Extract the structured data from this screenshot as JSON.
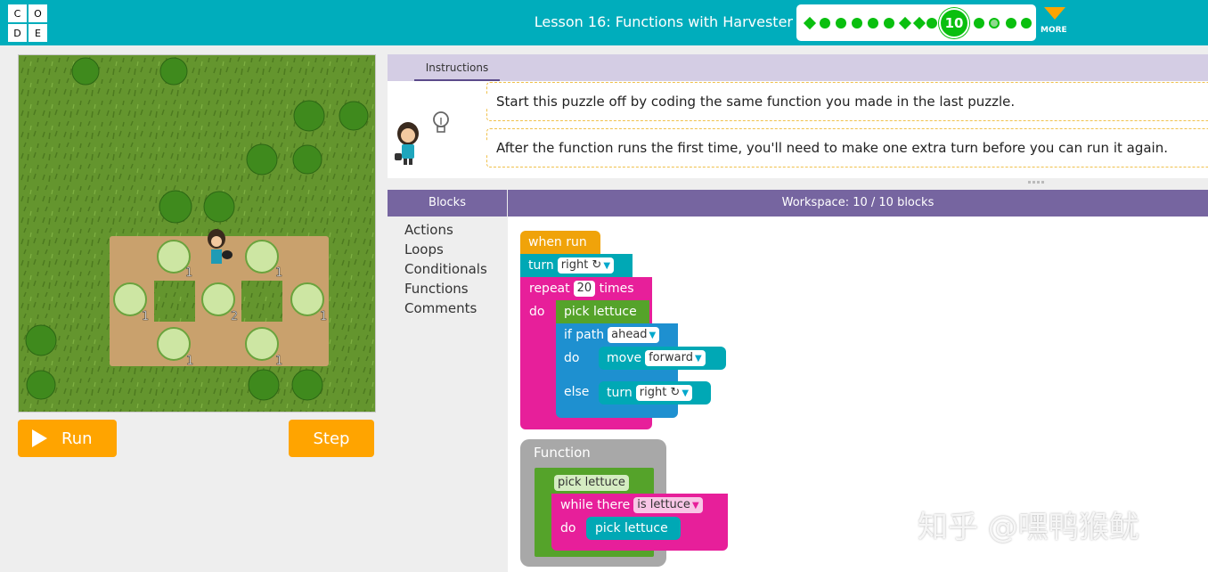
{
  "header": {
    "logo_letters": [
      "C",
      "O",
      "D",
      "E"
    ],
    "lesson_title": "Lesson 16: Functions with Harvester",
    "current_level": "10",
    "more_label": "MORE"
  },
  "game": {
    "lettuce_counts": [
      "1",
      "1",
      "1",
      "2",
      "1",
      "1",
      "1"
    ]
  },
  "controls": {
    "run_label": "Run",
    "step_label": "Step"
  },
  "instructions": {
    "tab_label": "Instructions",
    "lines": [
      "Start this puzzle off by coding the same function you made in the last puzzle.",
      "After the function runs the first time, you'll need to make one extra turn before you can run it again."
    ]
  },
  "toolbox": {
    "header": "Blocks",
    "categories": [
      "Actions",
      "Loops",
      "Conditionals",
      "Functions",
      "Comments"
    ]
  },
  "workspace": {
    "header": "Workspace: 10 / 10 blocks",
    "when_run": "when run",
    "turn_label": "turn",
    "turn_value": "right ↻",
    "repeat_label": "repeat",
    "repeat_count": "20",
    "times_label": "times",
    "do_label": "do",
    "pick_lettuce": "pick lettuce",
    "if_path_label": "if path",
    "if_path_value": "ahead",
    "move_label": "move",
    "move_value": "forward",
    "else_label": "else",
    "turn2_value": "right ↻",
    "function_label": "Function",
    "function_name": "pick lettuce",
    "while_label": "while",
    "there_label": "there",
    "there_value": "is lettuce",
    "do2_label": "do",
    "inner_pick": "pick lettuce"
  },
  "watermark": "知乎 @嘿鸭猴鱿",
  "colors": {
    "header_bg": "#00adbc",
    "run_orange": "#ffa400",
    "blocks_purple": "#7665a0",
    "events_orange": "#f0a30a",
    "action_teal": "#00a8b5",
    "loop_pink": "#e71f9a",
    "function_green": "#55a32a",
    "if_blue": "#1e90d0",
    "function_def_gray": "#a8a8a8"
  }
}
